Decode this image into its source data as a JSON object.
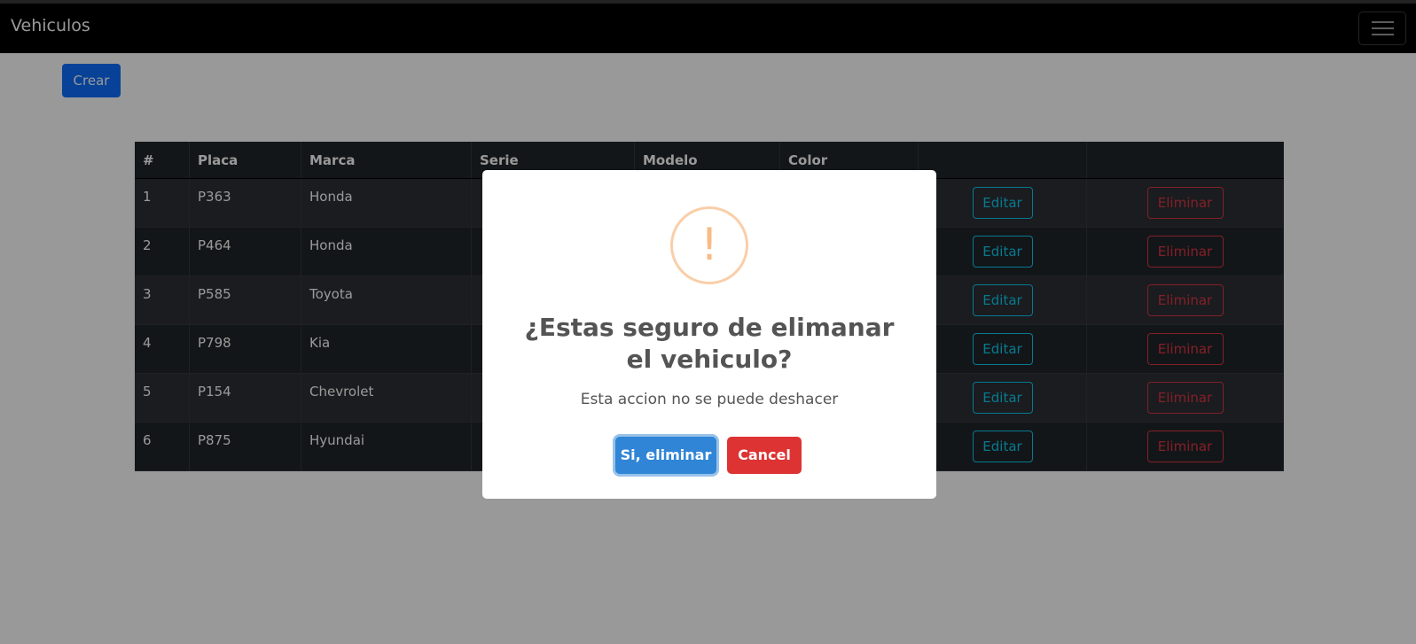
{
  "navbar": {
    "brand": "Vehiculos",
    "toggler_icon": "hamburger-icon"
  },
  "toolbar": {
    "create_label": "Crear"
  },
  "table": {
    "headers": [
      "#",
      "Placa",
      "Marca",
      "Serie",
      "Modelo",
      "Color",
      "",
      ""
    ],
    "rows": [
      {
        "num": "1",
        "placa": "P363",
        "marca": "Honda"
      },
      {
        "num": "2",
        "placa": "P464",
        "marca": "Honda"
      },
      {
        "num": "3",
        "placa": "P585",
        "marca": "Toyota"
      },
      {
        "num": "4",
        "placa": "P798",
        "marca": "Kia"
      },
      {
        "num": "5",
        "placa": "P154",
        "marca": "Chevrolet"
      },
      {
        "num": "6",
        "placa": "P875",
        "marca": "Hyundai"
      }
    ],
    "edit_label": "Editar",
    "delete_label": "Eliminar"
  },
  "modal": {
    "icon": "warning-icon",
    "icon_glyph": "!",
    "title": "¿Estas seguro de elimanar el vehiculo?",
    "text": "Esta accion no se puede deshacer",
    "confirm_label": "Si, eliminar",
    "cancel_label": "Cancel"
  },
  "colors": {
    "navbar_bg": "#000000",
    "primary": "#0d6efd",
    "info": "#0dcaf0",
    "danger": "#dc3545",
    "confirm": "#3085d6",
    "cancel": "#dd3333",
    "warning": "#f8bb86"
  }
}
